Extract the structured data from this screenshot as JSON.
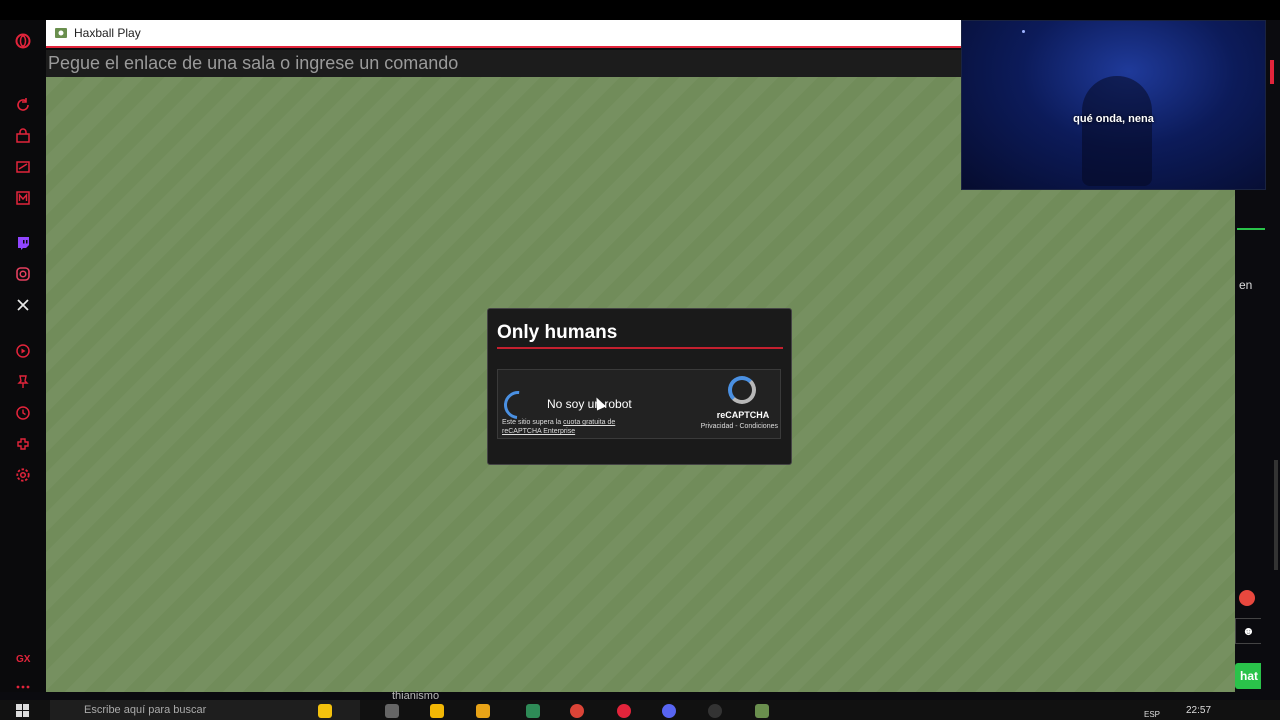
{
  "window": {
    "title": "Haxball Play"
  },
  "addressbar": {
    "placeholder": "Pegue el enlace de una sala o ingrese un comando"
  },
  "video_overlay": {
    "caption": "qué onda, nena"
  },
  "captcha_dialog": {
    "title": "Only humans",
    "checkbox_label": "No soy un robot",
    "notice_prefix": "Este sitio supera la",
    "notice_link": "cuota gratuita de reCAPTCHA Enterprise",
    "brand": "reCAPTCHA",
    "terms": "Privacidad - Condiciones"
  },
  "right_panel": {
    "text_fragment": "en",
    "button_fragment": "hat"
  },
  "stream": {
    "username": "thianismo"
  },
  "taskbar": {
    "search_placeholder": "Escribe aquí para buscar",
    "language": "ESP",
    "time": "22:57"
  },
  "colors": {
    "accent": "#e2243b",
    "field": "#718c5a",
    "dialog_bg": "#1a1a1a",
    "captcha_blue": "#4a90e2",
    "chat_green": "#2ac34a"
  },
  "sidebar_icons": [
    "opera-gx-logo",
    "refresh-icon",
    "bag-icon",
    "news-icon",
    "m-icon",
    "twitch-icon",
    "instagram-icon",
    "x-icon",
    "player-icon",
    "pin-icon",
    "history-icon",
    "extensions-icon",
    "settings-icon",
    "gx-icon",
    "more-icon"
  ]
}
